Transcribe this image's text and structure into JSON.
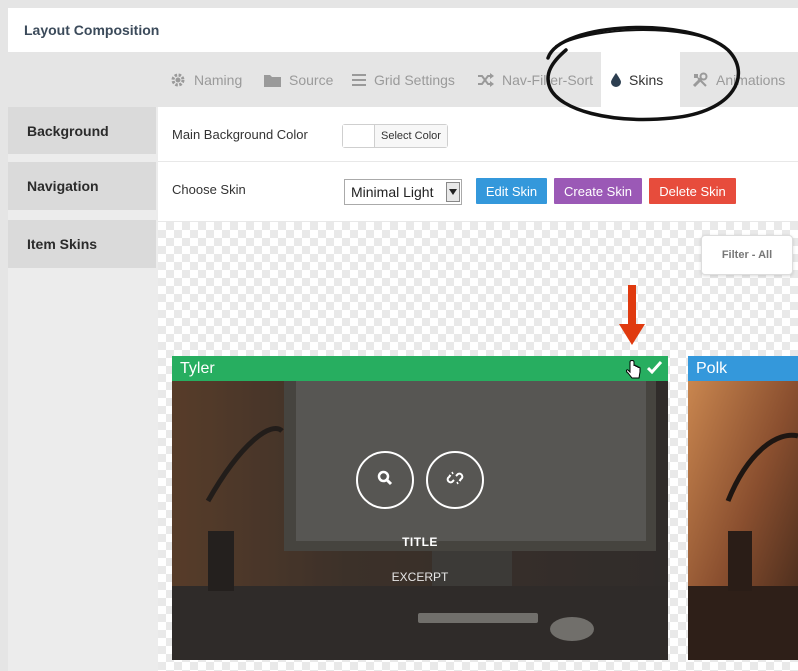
{
  "header": {
    "title": "Layout Composition"
  },
  "tabs": [
    {
      "label": "Naming",
      "icon": "gear-icon"
    },
    {
      "label": "Source",
      "icon": "folder-icon"
    },
    {
      "label": "Grid Settings",
      "icon": "list-icon"
    },
    {
      "label": "Nav-Filter-Sort",
      "icon": "shuffle-icon"
    },
    {
      "label": "Skins",
      "icon": "drop-icon",
      "active": true
    },
    {
      "label": "Animations",
      "icon": "tools-icon"
    }
  ],
  "sidebar": {
    "items": [
      {
        "label": "Background"
      },
      {
        "label": "Navigation"
      },
      {
        "label": "Item Skins"
      }
    ]
  },
  "background": {
    "label": "Main Background Color",
    "select_color_label": "Select Color"
  },
  "skin": {
    "label": "Choose Skin",
    "selected": "Minimal Light",
    "edit_label": "Edit Skin",
    "create_label": "Create Skin",
    "delete_label": "Delete Skin"
  },
  "filter": {
    "label": "Filter - All"
  },
  "cards": [
    {
      "name": "Tyler",
      "title": "TITLE",
      "excerpt": "EXCERPT"
    },
    {
      "name": "Polk"
    }
  ],
  "colors": {
    "edit": "#3498db",
    "create": "#9b59b6",
    "delete": "#e74c3c",
    "tyler_header": "#27ae60",
    "polk_header": "#3498db",
    "annotation_arrow": "#e03a0f"
  }
}
